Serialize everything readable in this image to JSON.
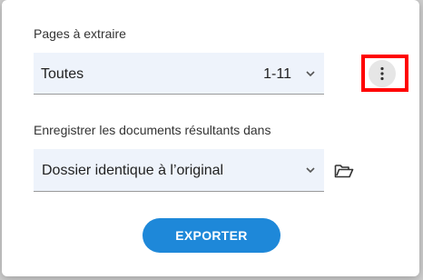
{
  "dialog": {
    "pages_label": "Pages à extraire",
    "pages_select": {
      "value": "Toutes",
      "range": "1-11"
    },
    "more_options_icon": "vertical-dots-icon",
    "save_label": "Enregistrer les documents résultants dans",
    "folder_select": {
      "value": "Dossier identique à l’original"
    },
    "folder_browse_icon": "folder-open-icon",
    "export_label": "EXPORTER"
  },
  "colors": {
    "accent": "#1e88d9",
    "select_bg": "#eef3fb",
    "highlight": "#ff0000",
    "text": "#333333"
  }
}
